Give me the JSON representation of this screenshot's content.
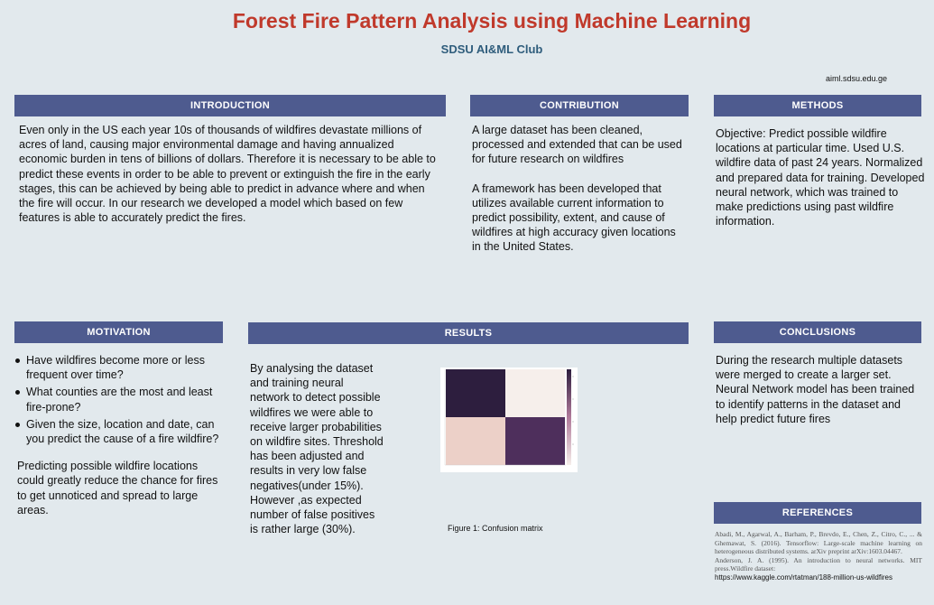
{
  "header": {
    "title": "Forest Fire Pattern Analysis using Machine Learning",
    "subtitle": "SDSU AI&ML Club",
    "website": "aiml.sdsu.edu.ge"
  },
  "introduction": {
    "heading": "INTRODUCTION",
    "text": "Even only in the US each year 10s of thousands of wildfires devastate millions of acres of land, causing major environmental damage and having annualized economic burden in tens of billions of dollars. Therefore it is necessary to be able to predict these events in order to be able to prevent or extinguish the fire in the early stages, this can be achieved by being able to predict in advance where and when the fire will occur. In our research we developed a model which based on few features is able to accurately predict the fires."
  },
  "contribution": {
    "heading": "CONTRIBUTION",
    "p1": "A large dataset has been cleaned, processed and extended that can be used for future research on wildfires",
    "p2": "A framework has been developed that utilizes available current information to predict possibility, extent, and cause of wildfires at high accuracy given locations in the United States."
  },
  "methods": {
    "heading": "METHODS",
    "text": "Objective: Predict possible wildfire locations at particular time. Used U.S. wildfire data of past 24 years. Normalized and prepared data for training. Developed neural network, which was trained to make predictions using past wildfire information."
  },
  "motivation": {
    "heading": "MOTIVATION",
    "bullets": [
      "Have wildfires become more or less frequent over time?",
      "What counties are the most and least fire-prone?",
      "Given the size, location and date, can you predict the cause of a fire wildfire?"
    ],
    "text": "Predicting possible wildfire locations could greatly reduce the chance for fires to get unnoticed and spread to large areas."
  },
  "results": {
    "heading": "RESULTS",
    "text": "By analysing the dataset and training neural network to detect possible wildfires we were able to receive larger probabilities on wildfire sites. Threshold has been adjusted and results in very low false negatives(under 15%). However ,as expected number of false positives is rather large (30%).",
    "figure_caption": "Figure 1: Confusion matrix"
  },
  "conclusions": {
    "heading": "CONCLUSIONS",
    "text": "During the research multiple datasets were merged to create a larger set. Neural Network model has been trained to identify patterns in the dataset and help predict future fires"
  },
  "references": {
    "heading": "REFERENCES",
    "ref1": "Abadi, M., Agarwal, A., Barham, P., Brevdo, E., Chen, Z., Citro, C., ... & Ghemawat, S. (2016). Tensorflow: Large-scale machine learning on heterogeneous distributed systems. arXiv preprint arXiv:1603.04467.",
    "ref2": "Anderson, J. A. (1995). An introduction to neural networks. MIT press.Wildfire dataset:",
    "link": "https://www.kaggle.com/rtatman/188-million-us-wildfires"
  },
  "confusion_matrix": {
    "cells": [
      {
        "row": 0,
        "col": 0,
        "color": "#2d1e3e"
      },
      {
        "row": 0,
        "col": 1,
        "color": "#f6efeb"
      },
      {
        "row": 1,
        "col": 0,
        "color": "#ecd0c8"
      },
      {
        "row": 1,
        "col": 1,
        "color": "#4e2f5c"
      }
    ]
  },
  "colors": {
    "header_bar": "#4e5b8f",
    "title": "#c0392b",
    "subtitle": "#2f5d7c",
    "background": "#e2e9ed"
  }
}
